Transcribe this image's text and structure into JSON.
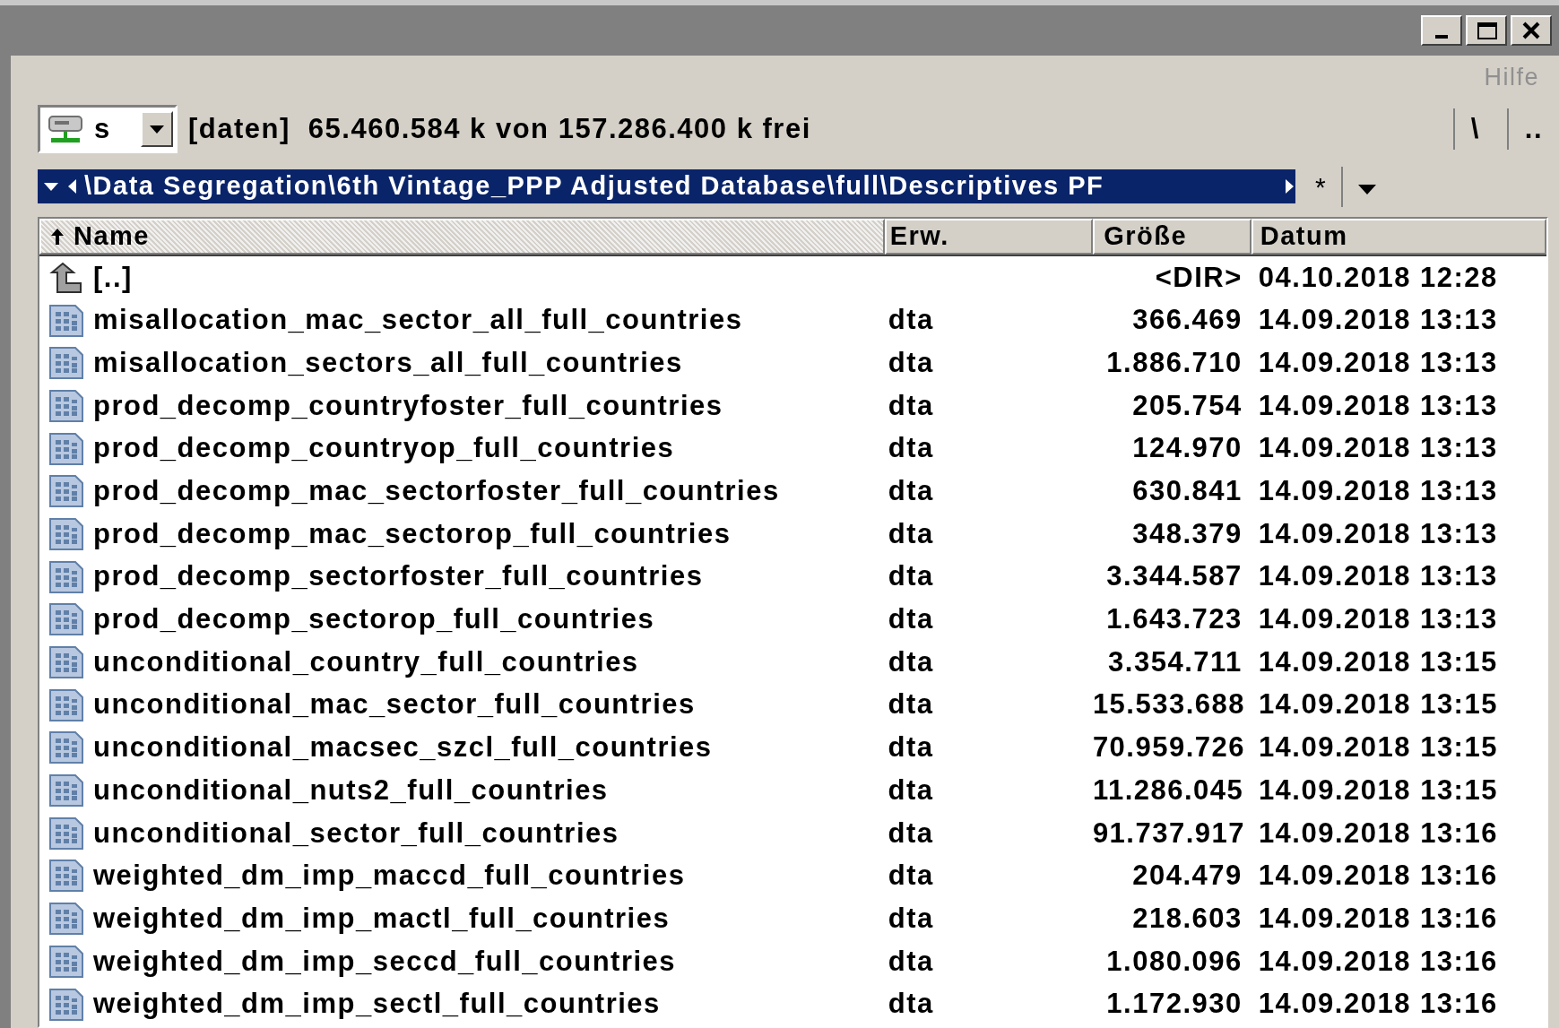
{
  "menu": [
    "Hilfe"
  ],
  "drive": {
    "letter": "s",
    "label": "[daten]",
    "free": "65.460.584 k von 157.286.400 k frei"
  },
  "toolbar_buttons": [
    "\\",
    ".."
  ],
  "path": "\\Data Segregation\\6th Vintage_PPP Adjusted Database\\full\\Descriptives PF",
  "path_buttons": [
    "*"
  ],
  "columns": [
    {
      "label": "Name",
      "sorted": true
    },
    {
      "label": "Erw.",
      "sorted": false
    },
    {
      "label": "Größe",
      "sorted": false
    },
    {
      "label": "Datum",
      "sorted": false
    }
  ],
  "rows": [
    {
      "kind": "parent",
      "name": "[..]",
      "size": "<DIR>",
      "date": "04.10.2018 12:28"
    },
    {
      "kind": "file",
      "name": "misallocation_mac_sector_all_full_countries",
      "ext": "dta",
      "size": "366.469",
      "date": "14.09.2018 13:13"
    },
    {
      "kind": "file",
      "name": "misallocation_sectors_all_full_countries",
      "ext": "dta",
      "size": "1.886.710",
      "date": "14.09.2018 13:13"
    },
    {
      "kind": "file",
      "name": "prod_decomp_countryfoster_full_countries",
      "ext": "dta",
      "size": "205.754",
      "date": "14.09.2018 13:13"
    },
    {
      "kind": "file",
      "name": "prod_decomp_countryop_full_countries",
      "ext": "dta",
      "size": "124.970",
      "date": "14.09.2018 13:13"
    },
    {
      "kind": "file",
      "name": "prod_decomp_mac_sectorfoster_full_countries",
      "ext": "dta",
      "size": "630.841",
      "date": "14.09.2018 13:13"
    },
    {
      "kind": "file",
      "name": "prod_decomp_mac_sectorop_full_countries",
      "ext": "dta",
      "size": "348.379",
      "date": "14.09.2018 13:13"
    },
    {
      "kind": "file",
      "name": "prod_decomp_sectorfoster_full_countries",
      "ext": "dta",
      "size": "3.344.587",
      "date": "14.09.2018 13:13"
    },
    {
      "kind": "file",
      "name": "prod_decomp_sectorop_full_countries",
      "ext": "dta",
      "size": "1.643.723",
      "date": "14.09.2018 13:13"
    },
    {
      "kind": "file",
      "name": "unconditional_country_full_countries",
      "ext": "dta",
      "size": "3.354.711",
      "date": "14.09.2018 13:15"
    },
    {
      "kind": "file",
      "name": "unconditional_mac_sector_full_countries",
      "ext": "dta",
      "size": "15.533.688",
      "date": "14.09.2018 13:15"
    },
    {
      "kind": "file",
      "name": "unconditional_macsec_szcl_full_countries",
      "ext": "dta",
      "size": "70.959.726",
      "date": "14.09.2018 13:15"
    },
    {
      "kind": "file",
      "name": "unconditional_nuts2_full_countries",
      "ext": "dta",
      "size": "11.286.045",
      "date": "14.09.2018 13:15"
    },
    {
      "kind": "file",
      "name": "unconditional_sector_full_countries",
      "ext": "dta",
      "size": "91.737.917",
      "date": "14.09.2018 13:16"
    },
    {
      "kind": "file",
      "name": "weighted_dm_imp_maccd_full_countries",
      "ext": "dta",
      "size": "204.479",
      "date": "14.09.2018 13:16"
    },
    {
      "kind": "file",
      "name": "weighted_dm_imp_mactl_full_countries",
      "ext": "dta",
      "size": "218.603",
      "date": "14.09.2018 13:16"
    },
    {
      "kind": "file",
      "name": "weighted_dm_imp_seccd_full_countries",
      "ext": "dta",
      "size": "1.080.096",
      "date": "14.09.2018 13:16"
    },
    {
      "kind": "file",
      "name": "weighted_dm_imp_sectl_full_countries",
      "ext": "dta",
      "size": "1.172.930",
      "date": "14.09.2018 13:16"
    }
  ]
}
